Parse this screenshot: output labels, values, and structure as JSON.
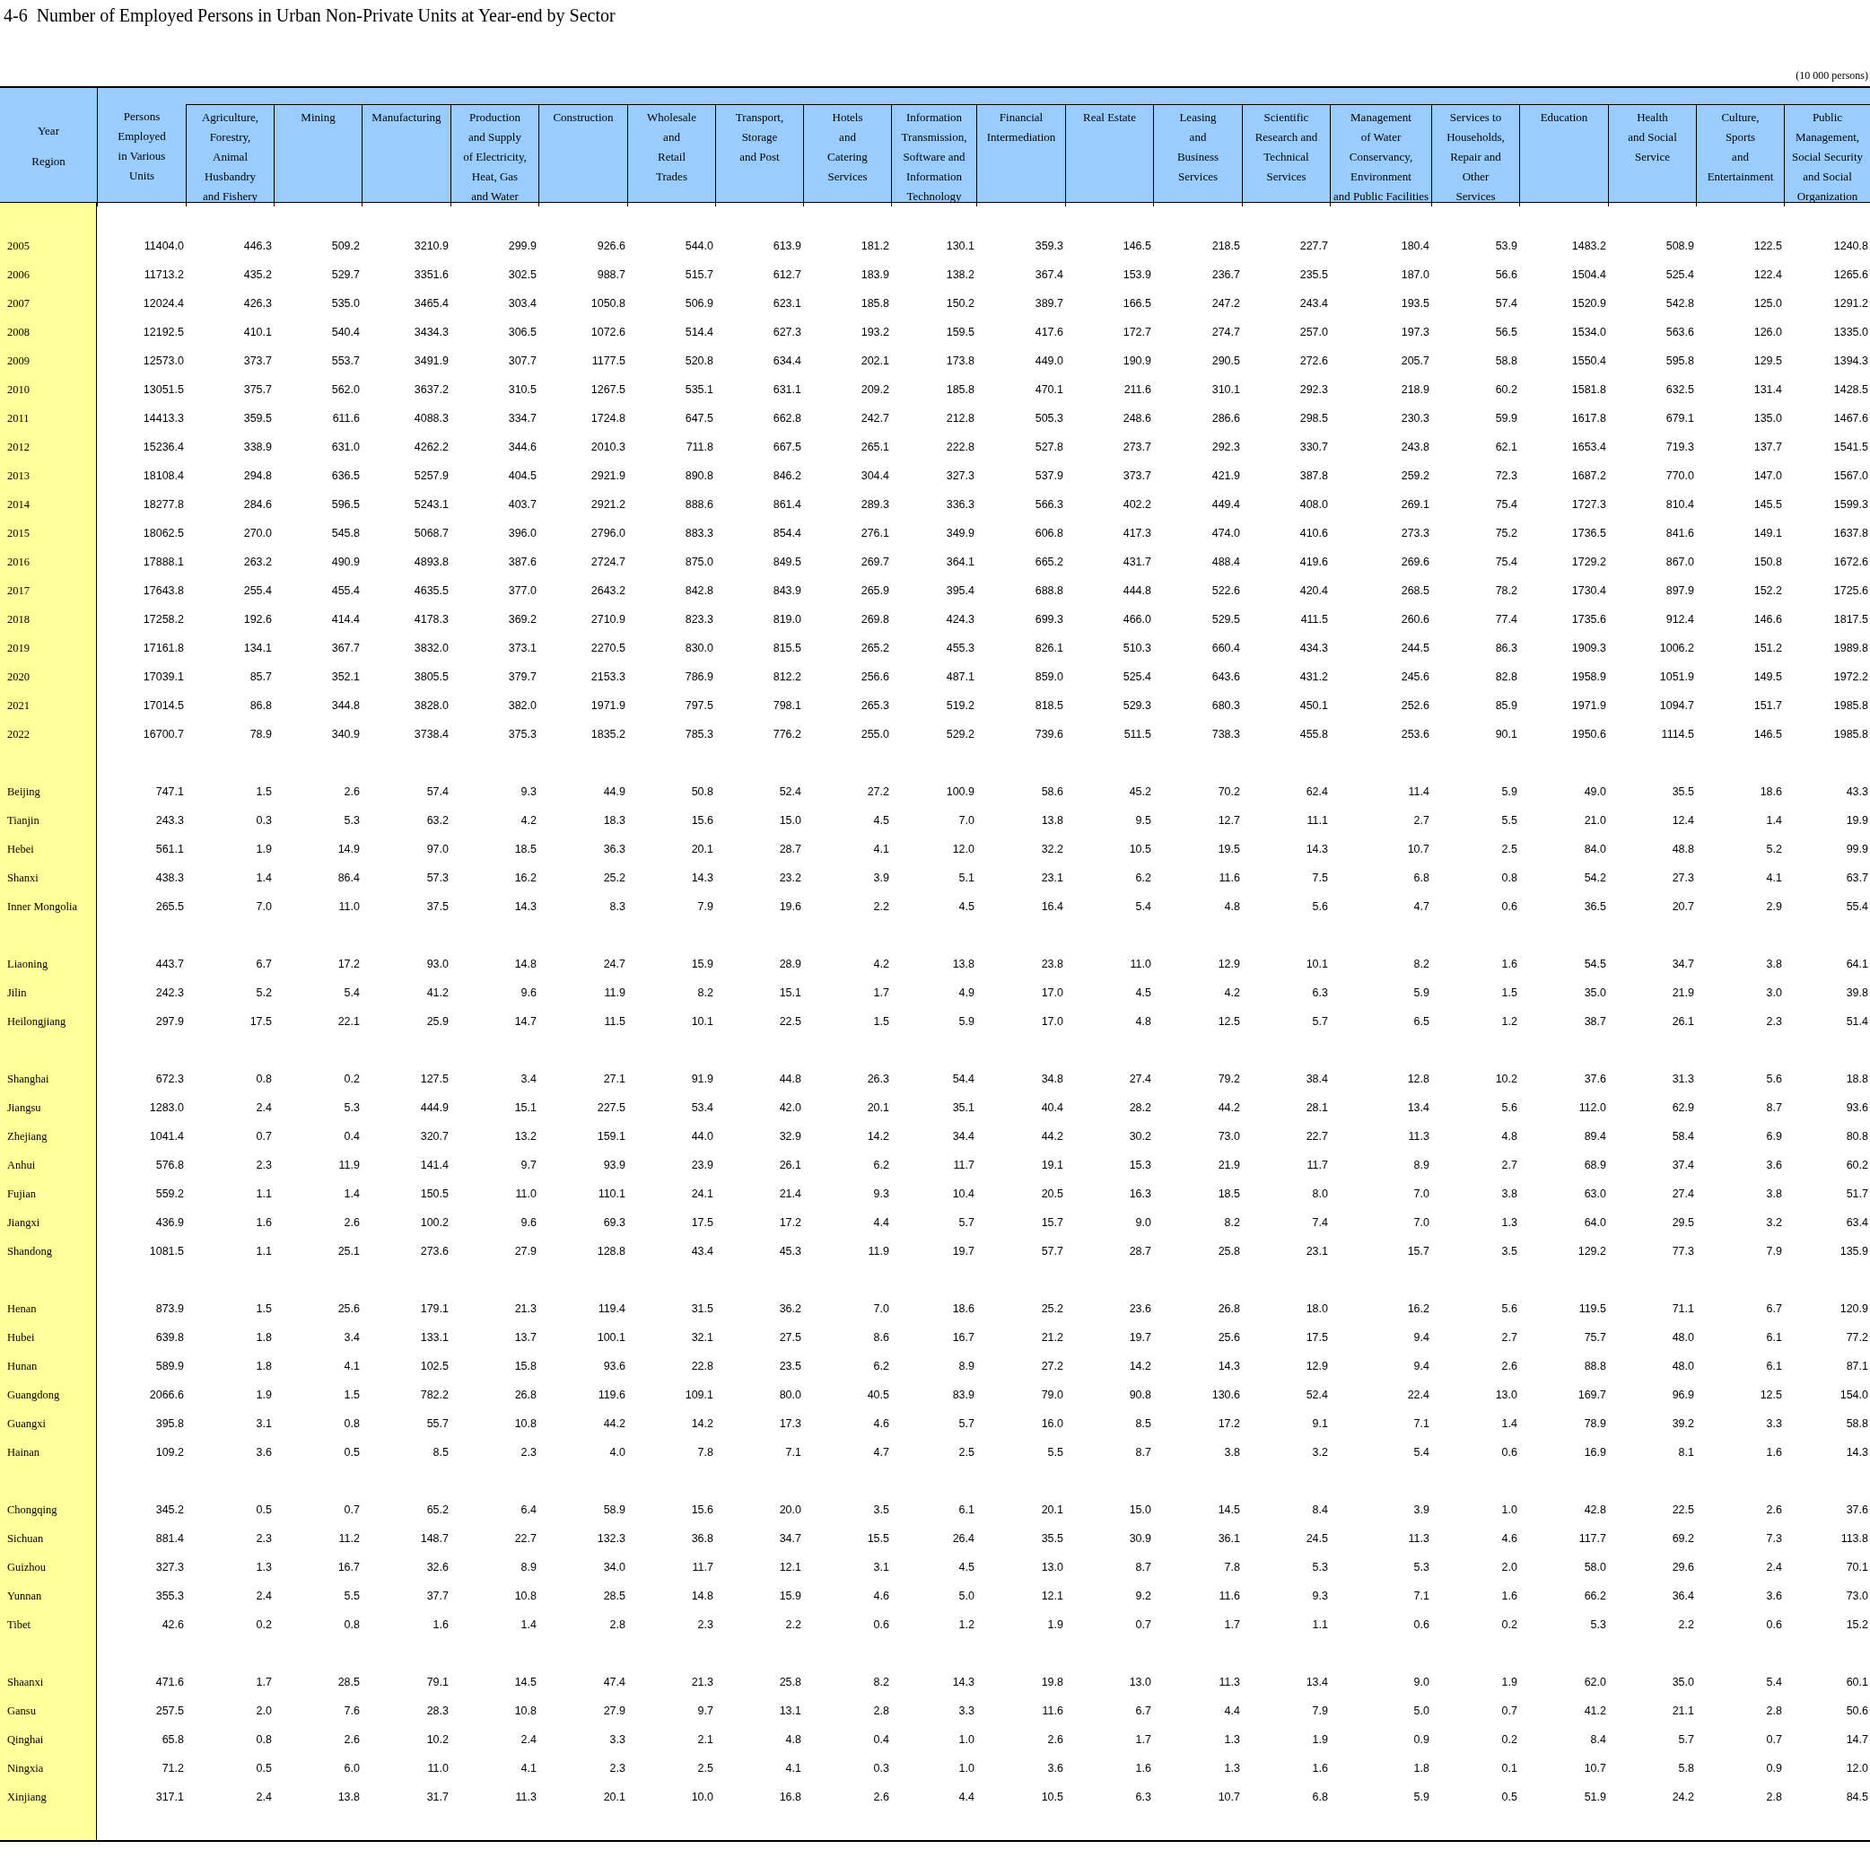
{
  "table_number": "4-6",
  "title": "Number of Employed Persons in Urban Non-Private Units at Year-end by Sector",
  "unit": "(10 000 persons)",
  "stub_header": [
    "Year",
    "Region"
  ],
  "columns": [
    {
      "lines": [
        "Persons",
        "Employed",
        "in Various",
        "Units"
      ]
    },
    {
      "lines": [
        "Agriculture,",
        "Forestry,",
        "Animal",
        "Husbandry",
        "and Fishery"
      ]
    },
    {
      "lines": [
        "Mining"
      ]
    },
    {
      "lines": [
        "Manufacturing"
      ]
    },
    {
      "lines": [
        "Production",
        "and Supply",
        "of Electricity,",
        "Heat, Gas",
        "and Water"
      ]
    },
    {
      "lines": [
        "Construction"
      ]
    },
    {
      "lines": [
        "Wholesale",
        "and",
        "Retail",
        "Trades"
      ]
    },
    {
      "lines": [
        "Transport,",
        "Storage",
        "and Post"
      ]
    },
    {
      "lines": [
        "Hotels",
        "and",
        "Catering",
        "Services"
      ]
    },
    {
      "lines": [
        "Information",
        "Transmission,",
        "Software and",
        "Information",
        "Technology"
      ]
    },
    {
      "lines": [
        "Financial",
        "Intermediation"
      ]
    },
    {
      "lines": [
        "Real Estate"
      ]
    },
    {
      "lines": [
        "Leasing",
        "and",
        "Business",
        "Services"
      ]
    },
    {
      "lines": [
        "Scientific",
        "Research and",
        "Technical",
        "Services"
      ]
    },
    {
      "lines": [
        "Management",
        "of Water",
        "Conservancy,",
        "Environment",
        "and Public Facilities"
      ]
    },
    {
      "lines": [
        "Services to",
        "Households,",
        "Repair and",
        "Other",
        "Services"
      ]
    },
    {
      "lines": [
        "Education"
      ]
    },
    {
      "lines": [
        "Health",
        "and Social",
        "Service"
      ]
    },
    {
      "lines": [
        "Culture,",
        "Sports",
        "and",
        "Entertainment"
      ]
    },
    {
      "lines": [
        "Public",
        "Management,",
        "Social Security",
        "and Social",
        "Organization"
      ]
    }
  ],
  "groups": [
    {
      "rows": [
        {
          "label": "2005",
          "values": [
            "11404.0",
            "446.3",
            "509.2",
            "3210.9",
            "299.9",
            "926.6",
            "544.0",
            "613.9",
            "181.2",
            "130.1",
            "359.3",
            "146.5",
            "218.5",
            "227.7",
            "180.4",
            "53.9",
            "1483.2",
            "508.9",
            "122.5",
            "1240.8"
          ]
        },
        {
          "label": "2006",
          "values": [
            "11713.2",
            "435.2",
            "529.7",
            "3351.6",
            "302.5",
            "988.7",
            "515.7",
            "612.7",
            "183.9",
            "138.2",
            "367.4",
            "153.9",
            "236.7",
            "235.5",
            "187.0",
            "56.6",
            "1504.4",
            "525.4",
            "122.4",
            "1265.6"
          ]
        },
        {
          "label": "2007",
          "values": [
            "12024.4",
            "426.3",
            "535.0",
            "3465.4",
            "303.4",
            "1050.8",
            "506.9",
            "623.1",
            "185.8",
            "150.2",
            "389.7",
            "166.5",
            "247.2",
            "243.4",
            "193.5",
            "57.4",
            "1520.9",
            "542.8",
            "125.0",
            "1291.2"
          ]
        },
        {
          "label": "2008",
          "values": [
            "12192.5",
            "410.1",
            "540.4",
            "3434.3",
            "306.5",
            "1072.6",
            "514.4",
            "627.3",
            "193.2",
            "159.5",
            "417.6",
            "172.7",
            "274.7",
            "257.0",
            "197.3",
            "56.5",
            "1534.0",
            "563.6",
            "126.0",
            "1335.0"
          ]
        },
        {
          "label": "2009",
          "values": [
            "12573.0",
            "373.7",
            "553.7",
            "3491.9",
            "307.7",
            "1177.5",
            "520.8",
            "634.4",
            "202.1",
            "173.8",
            "449.0",
            "190.9",
            "290.5",
            "272.6",
            "205.7",
            "58.8",
            "1550.4",
            "595.8",
            "129.5",
            "1394.3"
          ]
        },
        {
          "label": "2010",
          "values": [
            "13051.5",
            "375.7",
            "562.0",
            "3637.2",
            "310.5",
            "1267.5",
            "535.1",
            "631.1",
            "209.2",
            "185.8",
            "470.1",
            "211.6",
            "310.1",
            "292.3",
            "218.9",
            "60.2",
            "1581.8",
            "632.5",
            "131.4",
            "1428.5"
          ]
        },
        {
          "label": "2011",
          "values": [
            "14413.3",
            "359.5",
            "611.6",
            "4088.3",
            "334.7",
            "1724.8",
            "647.5",
            "662.8",
            "242.7",
            "212.8",
            "505.3",
            "248.6",
            "286.6",
            "298.5",
            "230.3",
            "59.9",
            "1617.8",
            "679.1",
            "135.0",
            "1467.6"
          ]
        },
        {
          "label": "2012",
          "values": [
            "15236.4",
            "338.9",
            "631.0",
            "4262.2",
            "344.6",
            "2010.3",
            "711.8",
            "667.5",
            "265.1",
            "222.8",
            "527.8",
            "273.7",
            "292.3",
            "330.7",
            "243.8",
            "62.1",
            "1653.4",
            "719.3",
            "137.7",
            "1541.5"
          ]
        },
        {
          "label": "2013",
          "values": [
            "18108.4",
            "294.8",
            "636.5",
            "5257.9",
            "404.5",
            "2921.9",
            "890.8",
            "846.2",
            "304.4",
            "327.3",
            "537.9",
            "373.7",
            "421.9",
            "387.8",
            "259.2",
            "72.3",
            "1687.2",
            "770.0",
            "147.0",
            "1567.0"
          ]
        },
        {
          "label": "2014",
          "values": [
            "18277.8",
            "284.6",
            "596.5",
            "5243.1",
            "403.7",
            "2921.2",
            "888.6",
            "861.4",
            "289.3",
            "336.3",
            "566.3",
            "402.2",
            "449.4",
            "408.0",
            "269.1",
            "75.4",
            "1727.3",
            "810.4",
            "145.5",
            "1599.3"
          ]
        },
        {
          "label": "2015",
          "values": [
            "18062.5",
            "270.0",
            "545.8",
            "5068.7",
            "396.0",
            "2796.0",
            "883.3",
            "854.4",
            "276.1",
            "349.9",
            "606.8",
            "417.3",
            "474.0",
            "410.6",
            "273.3",
            "75.2",
            "1736.5",
            "841.6",
            "149.1",
            "1637.8"
          ]
        },
        {
          "label": "2016",
          "values": [
            "17888.1",
            "263.2",
            "490.9",
            "4893.8",
            "387.6",
            "2724.7",
            "875.0",
            "849.5",
            "269.7",
            "364.1",
            "665.2",
            "431.7",
            "488.4",
            "419.6",
            "269.6",
            "75.4",
            "1729.2",
            "867.0",
            "150.8",
            "1672.6"
          ]
        },
        {
          "label": "2017",
          "values": [
            "17643.8",
            "255.4",
            "455.4",
            "4635.5",
            "377.0",
            "2643.2",
            "842.8",
            "843.9",
            "265.9",
            "395.4",
            "688.8",
            "444.8",
            "522.6",
            "420.4",
            "268.5",
            "78.2",
            "1730.4",
            "897.9",
            "152.2",
            "1725.6"
          ]
        },
        {
          "label": "2018",
          "values": [
            "17258.2",
            "192.6",
            "414.4",
            "4178.3",
            "369.2",
            "2710.9",
            "823.3",
            "819.0",
            "269.8",
            "424.3",
            "699.3",
            "466.0",
            "529.5",
            "411.5",
            "260.6",
            "77.4",
            "1735.6",
            "912.4",
            "146.6",
            "1817.5"
          ]
        },
        {
          "label": "2019",
          "values": [
            "17161.8",
            "134.1",
            "367.7",
            "3832.0",
            "373.1",
            "2270.5",
            "830.0",
            "815.5",
            "265.2",
            "455.3",
            "826.1",
            "510.3",
            "660.4",
            "434.3",
            "244.5",
            "86.3",
            "1909.3",
            "1006.2",
            "151.2",
            "1989.8"
          ]
        },
        {
          "label": "2020",
          "values": [
            "17039.1",
            "85.7",
            "352.1",
            "3805.5",
            "379.7",
            "2153.3",
            "786.9",
            "812.2",
            "256.6",
            "487.1",
            "859.0",
            "525.4",
            "643.6",
            "431.2",
            "245.6",
            "82.8",
            "1958.9",
            "1051.9",
            "149.5",
            "1972.2"
          ]
        },
        {
          "label": "2021",
          "values": [
            "17014.5",
            "86.8",
            "344.8",
            "3828.0",
            "382.0",
            "1971.9",
            "797.5",
            "798.1",
            "265.3",
            "519.2",
            "818.5",
            "529.3",
            "680.3",
            "450.1",
            "252.6",
            "85.9",
            "1971.9",
            "1094.7",
            "151.7",
            "1985.8"
          ]
        },
        {
          "label": "2022",
          "values": [
            "16700.7",
            "78.9",
            "340.9",
            "3738.4",
            "375.3",
            "1835.2",
            "785.3",
            "776.2",
            "255.0",
            "529.2",
            "739.6",
            "511.5",
            "738.3",
            "455.8",
            "253.6",
            "90.1",
            "1950.6",
            "1114.5",
            "146.5",
            "1985.8"
          ]
        }
      ]
    },
    {
      "rows": [
        {
          "label": "Beijing",
          "values": [
            "747.1",
            "1.5",
            "2.6",
            "57.4",
            "9.3",
            "44.9",
            "50.8",
            "52.4",
            "27.2",
            "100.9",
            "58.6",
            "45.2",
            "70.2",
            "62.4",
            "11.4",
            "5.9",
            "49.0",
            "35.5",
            "18.6",
            "43.3"
          ]
        },
        {
          "label": "Tianjin",
          "values": [
            "243.3",
            "0.3",
            "5.3",
            "63.2",
            "4.2",
            "18.3",
            "15.6",
            "15.0",
            "4.5",
            "7.0",
            "13.8",
            "9.5",
            "12.7",
            "11.1",
            "2.7",
            "5.5",
            "21.0",
            "12.4",
            "1.4",
            "19.9"
          ]
        },
        {
          "label": "Hebei",
          "values": [
            "561.1",
            "1.9",
            "14.9",
            "97.0",
            "18.5",
            "36.3",
            "20.1",
            "28.7",
            "4.1",
            "12.0",
            "32.2",
            "10.5",
            "19.5",
            "14.3",
            "10.7",
            "2.5",
            "84.0",
            "48.8",
            "5.2",
            "99.9"
          ]
        },
        {
          "label": "Shanxi",
          "values": [
            "438.3",
            "1.4",
            "86.4",
            "57.3",
            "16.2",
            "25.2",
            "14.3",
            "23.2",
            "3.9",
            "5.1",
            "23.1",
            "6.2",
            "11.6",
            "7.5",
            "6.8",
            "0.8",
            "54.2",
            "27.3",
            "4.1",
            "63.7"
          ]
        },
        {
          "label": "Inner Mongolia",
          "values": [
            "265.5",
            "7.0",
            "11.0",
            "37.5",
            "14.3",
            "8.3",
            "7.9",
            "19.6",
            "2.2",
            "4.5",
            "16.4",
            "5.4",
            "4.8",
            "5.6",
            "4.7",
            "0.6",
            "36.5",
            "20.7",
            "2.9",
            "55.4"
          ]
        }
      ]
    },
    {
      "rows": [
        {
          "label": "Liaoning",
          "values": [
            "443.7",
            "6.7",
            "17.2",
            "93.0",
            "14.8",
            "24.7",
            "15.9",
            "28.9",
            "4.2",
            "13.8",
            "23.8",
            "11.0",
            "12.9",
            "10.1",
            "8.2",
            "1.6",
            "54.5",
            "34.7",
            "3.8",
            "64.1"
          ]
        },
        {
          "label": "Jilin",
          "values": [
            "242.3",
            "5.2",
            "5.4",
            "41.2",
            "9.6",
            "11.9",
            "8.2",
            "15.1",
            "1.7",
            "4.9",
            "17.0",
            "4.5",
            "4.2",
            "6.3",
            "5.9",
            "1.5",
            "35.0",
            "21.9",
            "3.0",
            "39.8"
          ]
        },
        {
          "label": "Heilongjiang",
          "values": [
            "297.9",
            "17.5",
            "22.1",
            "25.9",
            "14.7",
            "11.5",
            "10.1",
            "22.5",
            "1.5",
            "5.9",
            "17.0",
            "4.8",
            "12.5",
            "5.7",
            "6.5",
            "1.2",
            "38.7",
            "26.1",
            "2.3",
            "51.4"
          ]
        }
      ]
    },
    {
      "rows": [
        {
          "label": "Shanghai",
          "values": [
            "672.3",
            "0.8",
            "0.2",
            "127.5",
            "3.4",
            "27.1",
            "91.9",
            "44.8",
            "26.3",
            "54.4",
            "34.8",
            "27.4",
            "79.2",
            "38.4",
            "12.8",
            "10.2",
            "37.6",
            "31.3",
            "5.6",
            "18.8"
          ]
        },
        {
          "label": "Jiangsu",
          "values": [
            "1283.0",
            "2.4",
            "5.3",
            "444.9",
            "15.1",
            "227.5",
            "53.4",
            "42.0",
            "20.1",
            "35.1",
            "40.4",
            "28.2",
            "44.2",
            "28.1",
            "13.4",
            "5.6",
            "112.0",
            "62.9",
            "8.7",
            "93.6"
          ]
        },
        {
          "label": "Zhejiang",
          "values": [
            "1041.4",
            "0.7",
            "0.4",
            "320.7",
            "13.2",
            "159.1",
            "44.0",
            "32.9",
            "14.2",
            "34.4",
            "44.2",
            "30.2",
            "73.0",
            "22.7",
            "11.3",
            "4.8",
            "89.4",
            "58.4",
            "6.9",
            "80.8"
          ]
        },
        {
          "label": "Anhui",
          "values": [
            "576.8",
            "2.3",
            "11.9",
            "141.4",
            "9.7",
            "93.9",
            "23.9",
            "26.1",
            "6.2",
            "11.7",
            "19.1",
            "15.3",
            "21.9",
            "11.7",
            "8.9",
            "2.7",
            "68.9",
            "37.4",
            "3.6",
            "60.2"
          ]
        },
        {
          "label": "Fujian",
          "values": [
            "559.2",
            "1.1",
            "1.4",
            "150.5",
            "11.0",
            "110.1",
            "24.1",
            "21.4",
            "9.3",
            "10.4",
            "20.5",
            "16.3",
            "18.5",
            "8.0",
            "7.0",
            "3.8",
            "63.0",
            "27.4",
            "3.8",
            "51.7"
          ]
        },
        {
          "label": "Jiangxi",
          "values": [
            "436.9",
            "1.6",
            "2.6",
            "100.2",
            "9.6",
            "69.3",
            "17.5",
            "17.2",
            "4.4",
            "5.7",
            "15.7",
            "9.0",
            "8.2",
            "7.4",
            "7.0",
            "1.3",
            "64.0",
            "29.5",
            "3.2",
            "63.4"
          ]
        },
        {
          "label": "Shandong",
          "values": [
            "1081.5",
            "1.1",
            "25.1",
            "273.6",
            "27.9",
            "128.8",
            "43.4",
            "45.3",
            "11.9",
            "19.7",
            "57.7",
            "28.7",
            "25.8",
            "23.1",
            "15.7",
            "3.5",
            "129.2",
            "77.3",
            "7.9",
            "135.9"
          ]
        }
      ]
    },
    {
      "rows": [
        {
          "label": "Henan",
          "values": [
            "873.9",
            "1.5",
            "25.6",
            "179.1",
            "21.3",
            "119.4",
            "31.5",
            "36.2",
            "7.0",
            "18.6",
            "25.2",
            "23.6",
            "26.8",
            "18.0",
            "16.2",
            "5.6",
            "119.5",
            "71.1",
            "6.7",
            "120.9"
          ]
        },
        {
          "label": "Hubei",
          "values": [
            "639.8",
            "1.8",
            "3.4",
            "133.1",
            "13.7",
            "100.1",
            "32.1",
            "27.5",
            "8.6",
            "16.7",
            "21.2",
            "19.7",
            "25.6",
            "17.5",
            "9.4",
            "2.7",
            "75.7",
            "48.0",
            "6.1",
            "77.2"
          ]
        },
        {
          "label": "Hunan",
          "values": [
            "589.9",
            "1.8",
            "4.1",
            "102.5",
            "15.8",
            "93.6",
            "22.8",
            "23.5",
            "6.2",
            "8.9",
            "27.2",
            "14.2",
            "14.3",
            "12.9",
            "9.4",
            "2.6",
            "88.8",
            "48.0",
            "6.1",
            "87.1"
          ]
        },
        {
          "label": "Guangdong",
          "values": [
            "2066.6",
            "1.9",
            "1.5",
            "782.2",
            "26.8",
            "119.6",
            "109.1",
            "80.0",
            "40.5",
            "83.9",
            "79.0",
            "90.8",
            "130.6",
            "52.4",
            "22.4",
            "13.0",
            "169.7",
            "96.9",
            "12.5",
            "154.0"
          ]
        },
        {
          "label": "Guangxi",
          "values": [
            "395.8",
            "3.1",
            "0.8",
            "55.7",
            "10.8",
            "44.2",
            "14.2",
            "17.3",
            "4.6",
            "5.7",
            "16.0",
            "8.5",
            "17.2",
            "9.1",
            "7.1",
            "1.4",
            "78.9",
            "39.2",
            "3.3",
            "58.8"
          ]
        },
        {
          "label": "Hainan",
          "values": [
            "109.2",
            "3.6",
            "0.5",
            "8.5",
            "2.3",
            "4.0",
            "7.8",
            "7.1",
            "4.7",
            "2.5",
            "5.5",
            "8.7",
            "3.8",
            "3.2",
            "5.4",
            "0.6",
            "16.9",
            "8.1",
            "1.6",
            "14.3"
          ]
        }
      ]
    },
    {
      "rows": [
        {
          "label": "Chongqing",
          "values": [
            "345.2",
            "0.5",
            "0.7",
            "65.2",
            "6.4",
            "58.9",
            "15.6",
            "20.0",
            "3.5",
            "6.1",
            "20.1",
            "15.0",
            "14.5",
            "8.4",
            "3.9",
            "1.0",
            "42.8",
            "22.5",
            "2.6",
            "37.6"
          ]
        },
        {
          "label": "Sichuan",
          "values": [
            "881.4",
            "2.3",
            "11.2",
            "148.7",
            "22.7",
            "132.3",
            "36.8",
            "34.7",
            "15.5",
            "26.4",
            "35.5",
            "30.9",
            "36.1",
            "24.5",
            "11.3",
            "4.6",
            "117.7",
            "69.2",
            "7.3",
            "113.8"
          ]
        },
        {
          "label": "Guizhou",
          "values": [
            "327.3",
            "1.3",
            "16.7",
            "32.6",
            "8.9",
            "34.0",
            "11.7",
            "12.1",
            "3.1",
            "4.5",
            "13.0",
            "8.7",
            "7.8",
            "5.3",
            "5.3",
            "2.0",
            "58.0",
            "29.6",
            "2.4",
            "70.1"
          ]
        },
        {
          "label": "Yunnan",
          "values": [
            "355.3",
            "2.4",
            "5.5",
            "37.7",
            "10.8",
            "28.5",
            "14.8",
            "15.9",
            "4.6",
            "5.0",
            "12.1",
            "9.2",
            "11.6",
            "9.3",
            "7.1",
            "1.6",
            "66.2",
            "36.4",
            "3.6",
            "73.0"
          ]
        },
        {
          "label": "Tibet",
          "values": [
            "42.6",
            "0.2",
            "0.8",
            "1.6",
            "1.4",
            "2.8",
            "2.3",
            "2.2",
            "0.6",
            "1.2",
            "1.9",
            "0.7",
            "1.7",
            "1.1",
            "0.6",
            "0.2",
            "5.3",
            "2.2",
            "0.6",
            "15.2"
          ]
        }
      ]
    },
    {
      "rows": [
        {
          "label": "Shaanxi",
          "values": [
            "471.6",
            "1.7",
            "28.5",
            "79.1",
            "14.5",
            "47.4",
            "21.3",
            "25.8",
            "8.2",
            "14.3",
            "19.8",
            "13.0",
            "11.3",
            "13.4",
            "9.0",
            "1.9",
            "62.0",
            "35.0",
            "5.4",
            "60.1"
          ]
        },
        {
          "label": "Gansu",
          "values": [
            "257.5",
            "2.0",
            "7.6",
            "28.3",
            "10.8",
            "27.9",
            "9.7",
            "13.1",
            "2.8",
            "3.3",
            "11.6",
            "6.7",
            "4.4",
            "7.9",
            "5.0",
            "0.7",
            "41.2",
            "21.1",
            "2.8",
            "50.6"
          ]
        },
        {
          "label": "Qinghai",
          "values": [
            "65.8",
            "0.8",
            "2.6",
            "10.2",
            "2.4",
            "3.3",
            "2.1",
            "4.8",
            "0.4",
            "1.0",
            "2.6",
            "1.7",
            "1.3",
            "1.9",
            "0.9",
            "0.2",
            "8.4",
            "5.7",
            "0.7",
            "14.7"
          ]
        },
        {
          "label": "Ningxia",
          "values": [
            "71.2",
            "0.5",
            "6.0",
            "11.0",
            "4.1",
            "2.3",
            "2.5",
            "4.1",
            "0.3",
            "1.0",
            "3.6",
            "1.6",
            "1.3",
            "1.6",
            "1.8",
            "0.1",
            "10.7",
            "5.8",
            "0.9",
            "12.0"
          ]
        },
        {
          "label": "Xinjiang",
          "values": [
            "317.1",
            "2.4",
            "13.8",
            "31.7",
            "11.3",
            "20.1",
            "10.0",
            "16.8",
            "2.6",
            "4.4",
            "10.5",
            "6.3",
            "10.7",
            "6.8",
            "5.9",
            "0.5",
            "51.9",
            "24.2",
            "2.8",
            "84.5"
          ]
        }
      ]
    }
  ]
}
